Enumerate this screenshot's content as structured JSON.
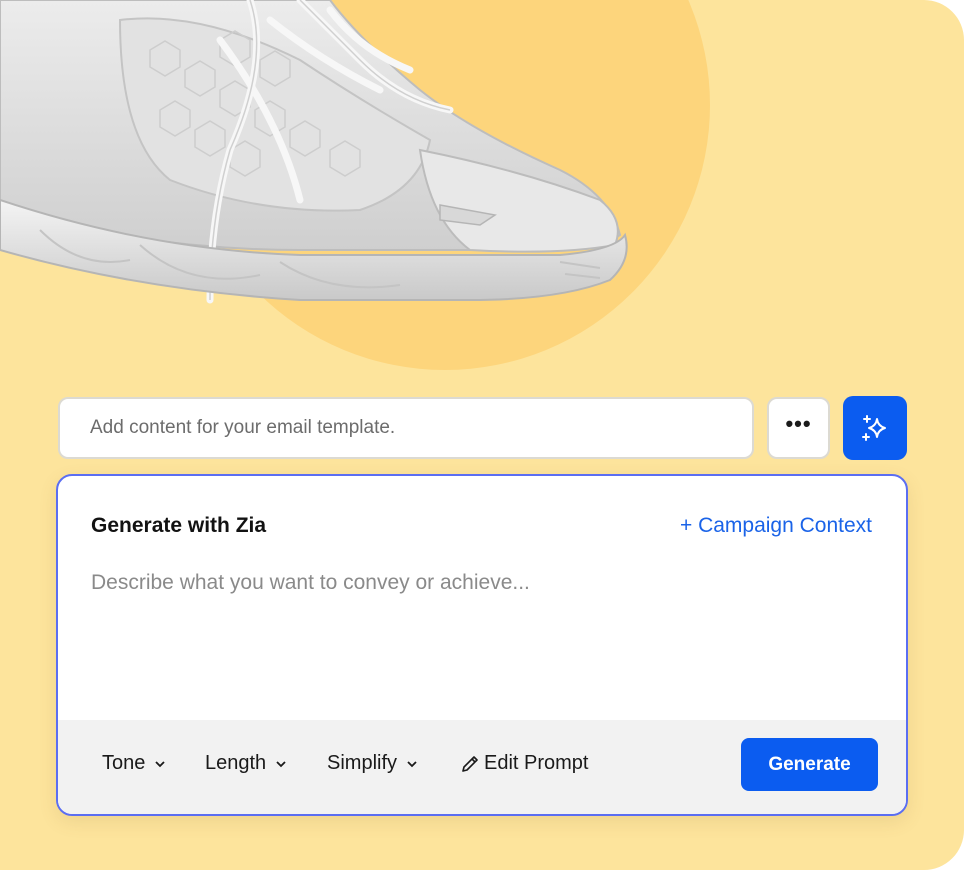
{
  "hero": {
    "image": "white-sneaker-icon",
    "background_color": "#fde49c",
    "circle_color": "#fdd57c"
  },
  "prompt_bar": {
    "placeholder": "Add content for your email template.",
    "more_icon": "ellipsis-icon",
    "ai_icon": "sparkle-icon"
  },
  "panel": {
    "title": "Generate with Zia",
    "context_link": "+ Campaign Context",
    "description_placeholder": "Describe what you want to convey or achieve...",
    "border_color": "#5b6ef2"
  },
  "toolbar": {
    "tone_label": "Tone",
    "length_label": "Length",
    "simplify_label": "Simplify",
    "edit_prompt_label": "Edit Prompt",
    "generate_label": "Generate",
    "accent_color": "#0b5cf0"
  }
}
